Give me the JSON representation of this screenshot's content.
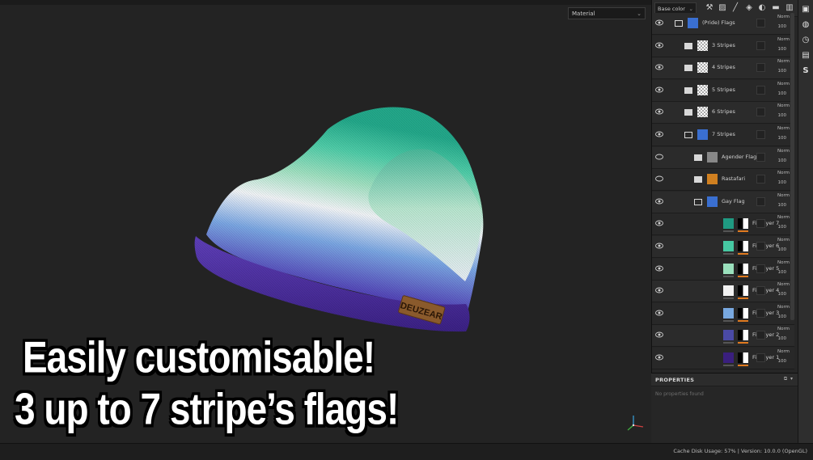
{
  "viewport": {
    "material_dropdown": "Material",
    "overlay_line1": "Easily customisable!",
    "overlay_line2": "3 up to 7 stripe’s flags!",
    "hat_logo_text": "DEUZEAR"
  },
  "layers_panel": {
    "channel_dropdown": "Base color",
    "toolbar_icons": [
      "paint-layer-icon",
      "fill-layer-icon",
      "brush-icon",
      "fill-bucket-icon",
      "effects-icon",
      "folder-icon",
      "trash-icon"
    ],
    "layers": [
      {
        "name": "(Pride) Flags",
        "type": "folder-open",
        "thumb": "#3a6fd0",
        "blend": "Norm",
        "opacity": "100",
        "visible": true,
        "indent": 0
      },
      {
        "name": "3 Stripes",
        "type": "folder",
        "thumb": "checker",
        "blend": "Norm",
        "opacity": "100",
        "visible": true,
        "indent": 1
      },
      {
        "name": "4 Stripes",
        "type": "folder",
        "thumb": "checker",
        "blend": "Norm",
        "opacity": "100",
        "visible": true,
        "indent": 1
      },
      {
        "name": "5 Stripes",
        "type": "folder",
        "thumb": "checker",
        "blend": "Norm",
        "opacity": "100",
        "visible": true,
        "indent": 1
      },
      {
        "name": "6 Stripes",
        "type": "folder",
        "thumb": "checker",
        "blend": "Norm",
        "opacity": "100",
        "visible": true,
        "indent": 1
      },
      {
        "name": "7 Stripes",
        "type": "folder-open",
        "thumb": "#3a6fd0",
        "blend": "Norm",
        "opacity": "100",
        "visible": true,
        "indent": 1
      },
      {
        "name": "Agender Flag",
        "type": "folder",
        "thumb": "#888888",
        "blend": "Norm",
        "opacity": "100",
        "visible": false,
        "indent": 2
      },
      {
        "name": "Rastafari",
        "type": "folder",
        "thumb": "#d08020",
        "blend": "Norm",
        "opacity": "100",
        "visible": false,
        "indent": 2
      },
      {
        "name": "Gay Flag",
        "type": "folder-open",
        "thumb": "#3a6fd0",
        "blend": "Norm",
        "opacity": "100",
        "visible": true,
        "indent": 2
      },
      {
        "name": "Fill layer 7",
        "type": "fill",
        "thumb": "#1f9a82",
        "blend": "Norm",
        "opacity": "100",
        "visible": true,
        "indent": 3
      },
      {
        "name": "Fill layer 6",
        "type": "fill",
        "thumb": "#46c8a2",
        "blend": "Norm",
        "opacity": "100",
        "visible": true,
        "indent": 3
      },
      {
        "name": "Fill layer 5",
        "type": "fill",
        "thumb": "#9ae0bc",
        "blend": "Norm",
        "opacity": "100",
        "visible": true,
        "indent": 3
      },
      {
        "name": "Fill layer 4",
        "type": "fill",
        "thumb": "#f2f2f2",
        "blend": "Norm",
        "opacity": "100",
        "visible": true,
        "indent": 3
      },
      {
        "name": "Fill layer 3",
        "type": "fill",
        "thumb": "#78a8e0",
        "blend": "Norm",
        "opacity": "100",
        "visible": true,
        "indent": 3
      },
      {
        "name": "Fill layer 2",
        "type": "fill",
        "thumb": "#4a4aa6",
        "blend": "Norm",
        "opacity": "100",
        "visible": true,
        "indent": 3
      },
      {
        "name": "Fill layer 1",
        "type": "fill",
        "thumb": "#3a1f7e",
        "blend": "Norm",
        "opacity": "100",
        "visible": true,
        "indent": 3
      }
    ]
  },
  "properties_panel": {
    "title": "PROPERTIES",
    "empty_text": "No properties found"
  },
  "side_strip_icons": [
    "camera-icon",
    "globe-icon",
    "history-icon",
    "log-icon",
    "substance-icon"
  ],
  "status_bar": {
    "text": "Cache Disk Usage:   57% | Version: 10.0.0 (OpenGL)"
  },
  "colors": {
    "accent_orange": "#e07a1f",
    "background": "#232323"
  }
}
